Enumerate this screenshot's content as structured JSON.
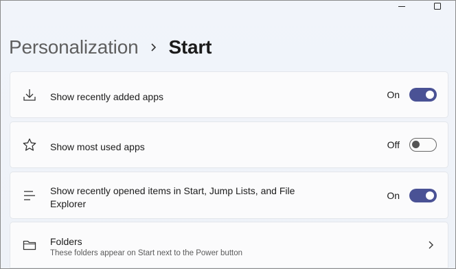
{
  "window": {
    "controls": [
      "minimize-icon",
      "maximize-icon"
    ]
  },
  "header": {
    "parent": "Personalization",
    "current": "Start"
  },
  "settings": [
    {
      "icon": "download-icon",
      "label": "Show recently added apps",
      "state": "On",
      "toggle": true
    },
    {
      "icon": "star-icon",
      "label": "Show most used apps",
      "state": "Off",
      "toggle": false
    },
    {
      "icon": "list-icon",
      "label": "Show recently opened items in Start, Jump Lists, and File Explorer",
      "state": "On",
      "toggle": true
    }
  ],
  "folders": {
    "icon": "folder-icon",
    "label": "Folders",
    "description": "These folders appear on Start next to the Power button"
  },
  "colors": {
    "accent": "#4a5295",
    "background": "#eef2f9",
    "card": "#fbfbfc"
  }
}
